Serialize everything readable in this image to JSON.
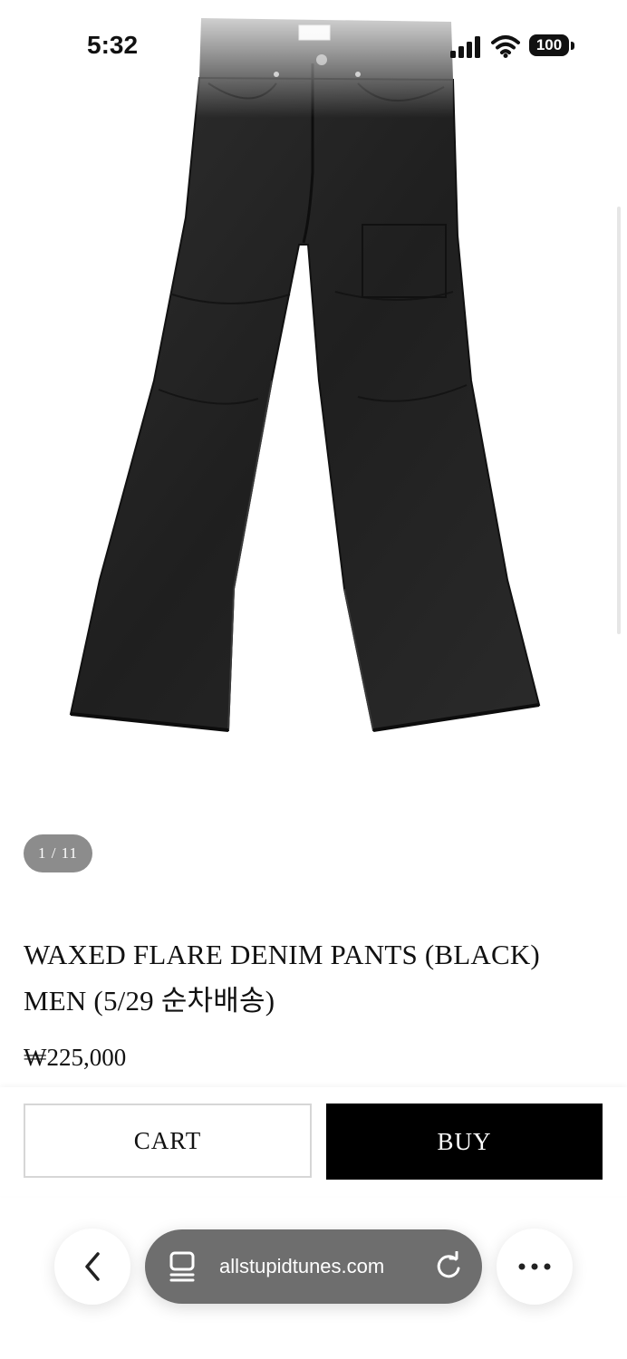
{
  "status_bar": {
    "time": "5:32",
    "battery": "100"
  },
  "product": {
    "image_counter": "1 / 11",
    "title": "WAXED FLARE DENIM PANTS (BLACK) MEN (5/29 순차배송)",
    "price": "₩225,000"
  },
  "actions": {
    "cart_label": "CART",
    "buy_label": "BUY"
  },
  "browser": {
    "url": "allstupidtunes.com",
    "icons": [
      "back-icon",
      "tab-icon",
      "reload-icon",
      "more-icon"
    ]
  },
  "colors": {
    "buy_bg": "#000000",
    "counter_bg": "#8c8c8c",
    "address_bar_bg": "#6e6e6e"
  }
}
